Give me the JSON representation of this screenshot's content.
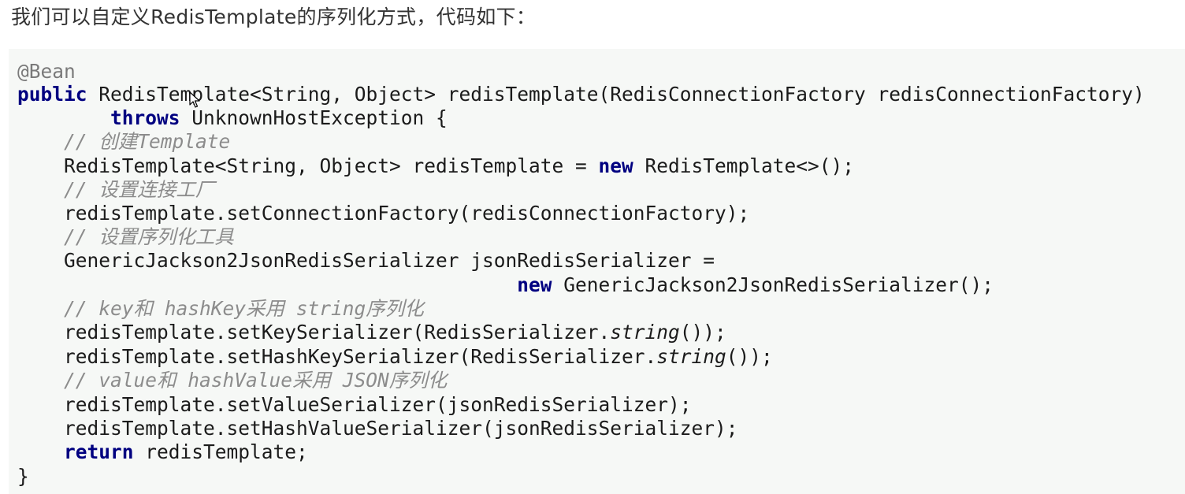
{
  "intro": "我们可以自定义RedisTemplate的序列化方式，代码如下：",
  "code": {
    "annotation": "@Bean",
    "line2": {
      "kw_public": "public",
      "rest": " RedisTemplate<String, Object> redisTemplate(RedisConnectionFactory redisConnectionFactory)"
    },
    "line3": {
      "indent": "        ",
      "kw_throws": "throws",
      "rest": " UnknownHostException {"
    },
    "comment_create": "// 创建Template",
    "line5": {
      "pre": "RedisTemplate<String, Object> redisTemplate = ",
      "kw_new": "new",
      "post": " RedisTemplate<>();"
    },
    "comment_factory": "// 设置连接工厂",
    "line7": "redisTemplate.setConnectionFactory(redisConnectionFactory);",
    "comment_serializer": "// 设置序列化工具",
    "line9": "GenericJackson2JsonRedisSerializer jsonRedisSerializer =",
    "line10": {
      "kw_new": "new",
      "post": " GenericJackson2JsonRedisSerializer();"
    },
    "comment_key": "// key和 hashKey采用 string序列化",
    "line12": {
      "pre": "redisTemplate.setKeySerializer(RedisSerializer.",
      "method": "string",
      "post": "());"
    },
    "line13": {
      "pre": "redisTemplate.setHashKeySerializer(RedisSerializer.",
      "method": "string",
      "post": "());"
    },
    "comment_value": "// value和 hashValue采用 JSON序列化",
    "line15": "redisTemplate.setValueSerializer(jsonRedisSerializer);",
    "line16": "redisTemplate.setHashValueSerializer(jsonRedisSerializer);",
    "line17": {
      "kw_return": "return",
      "post": " redisTemplate;"
    },
    "line18": "}"
  }
}
